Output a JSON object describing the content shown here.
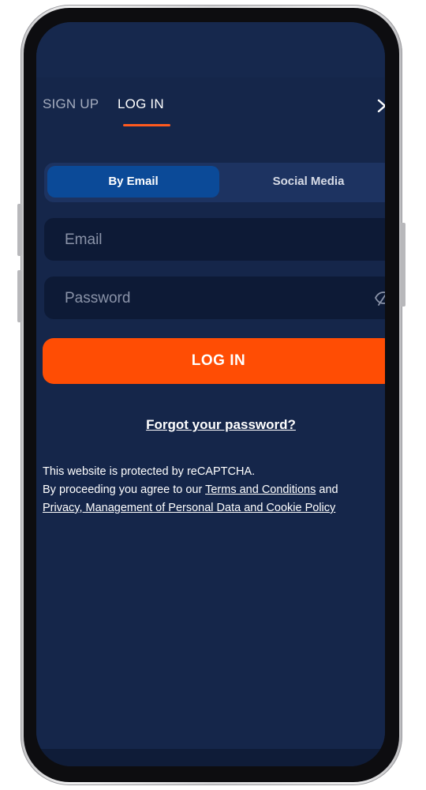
{
  "tabs": {
    "signup_label": "SIGN UP",
    "login_label": "LOG IN",
    "active": "LOG IN"
  },
  "close_icon": "close-icon",
  "method_switch": {
    "by_email_label": "By Email",
    "social_media_label": "Social Media",
    "selected": "By Email"
  },
  "form": {
    "email_placeholder": "Email",
    "email_value": "",
    "password_placeholder": "Password",
    "password_value": "",
    "password_visibility_icon": "eye-off-icon"
  },
  "login_button_label": "LOG IN",
  "forgot_password_label": "Forgot your password?",
  "legal": {
    "recaptcha_text": "This website is protected by reCAPTCHA.",
    "agree_prefix": "By proceeding you agree to our ",
    "terms_link": "Terms and Conditions",
    "and_text": " and",
    "privacy_link": "Privacy, Management of Personal Data and Cookie Policy"
  },
  "colors": {
    "background": "#15264a",
    "accent": "#ff4d04",
    "active_segment": "#0b4a98",
    "input_background": "#0d1a36"
  }
}
